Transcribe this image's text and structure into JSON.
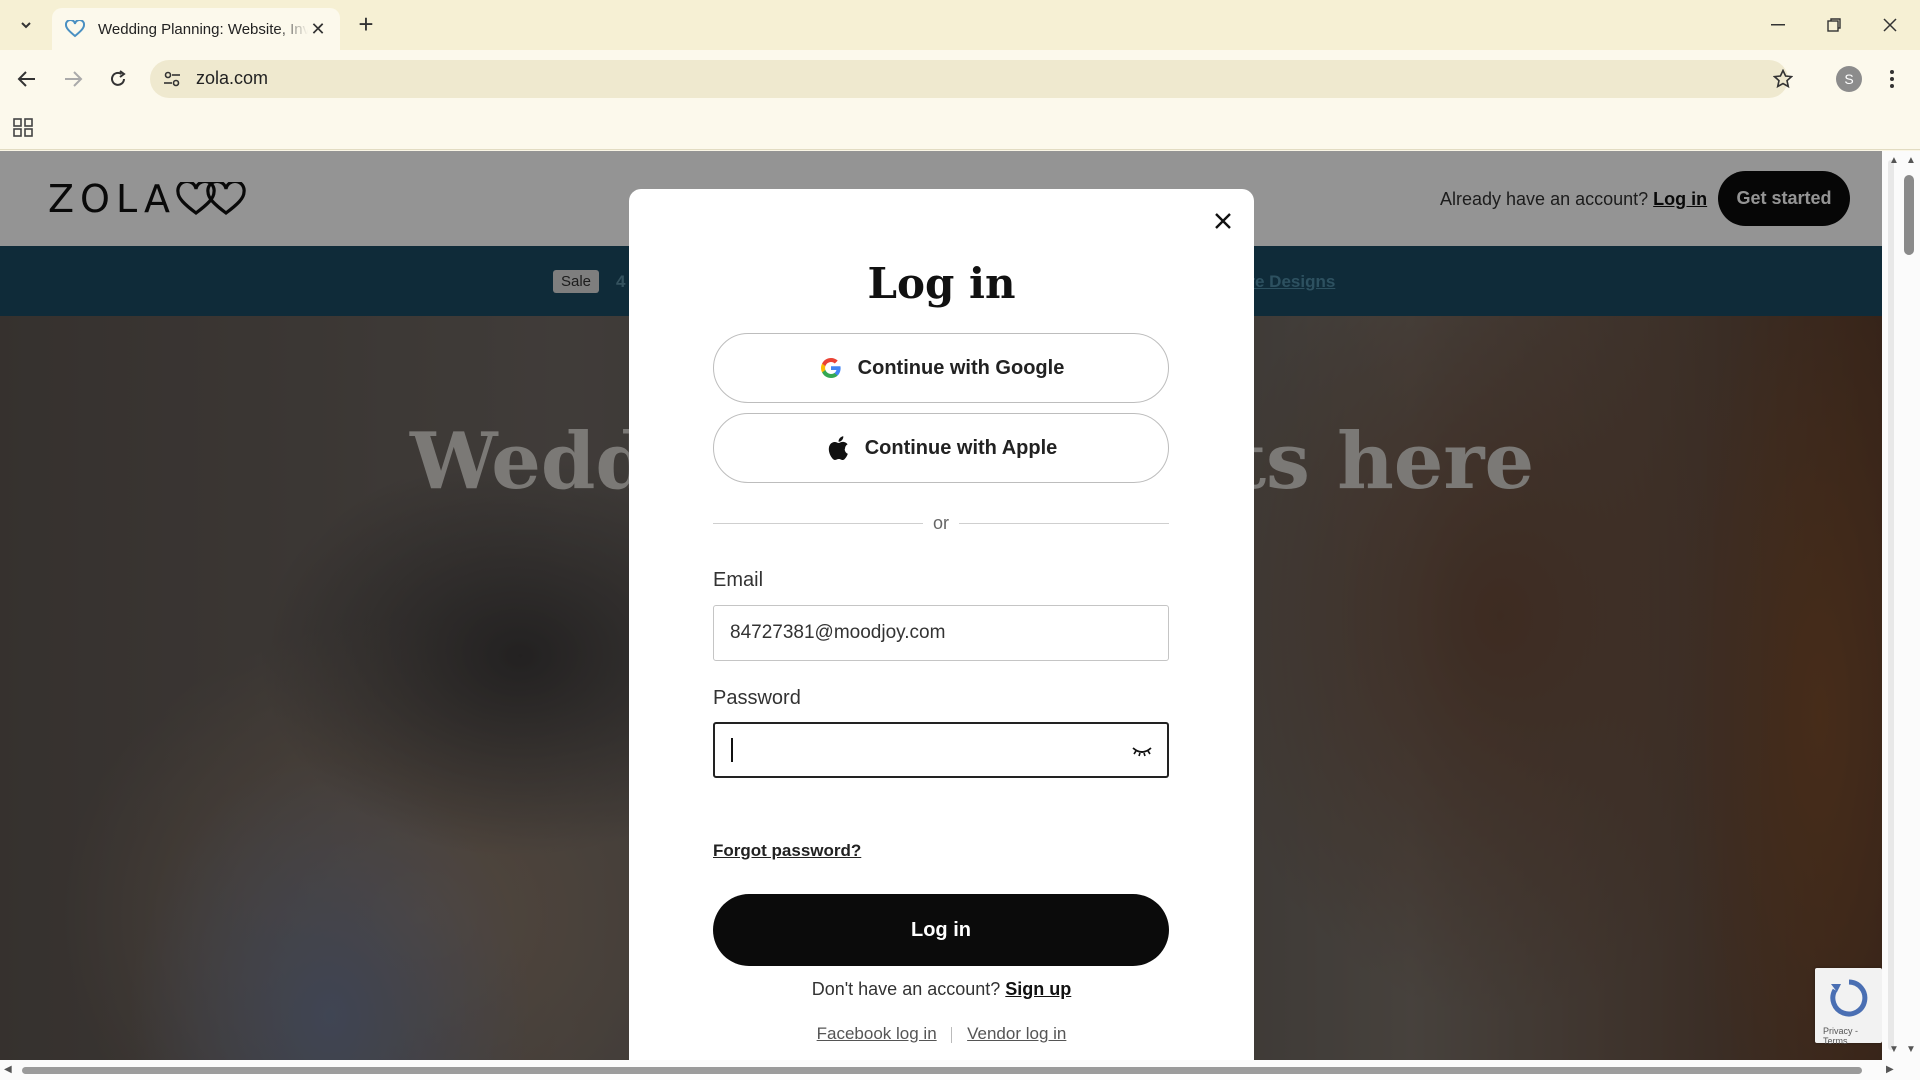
{
  "browser": {
    "tab_title": "Wedding Planning: Website, Invitations",
    "url": "zola.com",
    "profile_initial": "S",
    "accent": "#f6f0d4"
  },
  "header": {
    "logo_text": "ZOLA",
    "already_text": "Already have an account?",
    "login_link": "Log in",
    "get_started": "Get started"
  },
  "promo": {
    "sale_badge": "Sale",
    "left_text": "4",
    "link_text": "ore Designs"
  },
  "hero": {
    "left_fragment": "Wedd",
    "right_fragment": "ts here"
  },
  "modal": {
    "title": "Log in",
    "google_label": "Continue with Google",
    "apple_label": "Continue with Apple",
    "or_text": "or",
    "email_label": "Email",
    "email_value": "84727381@moodjoy.com",
    "password_label": "Password",
    "password_value": "",
    "forgot_label": "Forgot password?",
    "login_button": "Log in",
    "signup_prompt": "Don't have an account?",
    "signup_link": "Sign up",
    "facebook_link": "Facebook log in",
    "vendor_link": "Vendor log in"
  },
  "recaptcha": {
    "text": "Privacy - Terms"
  },
  "icons": {
    "tab_favicon": "heart-icon",
    "site_info": "tune-icon",
    "bookmark": "star-icon",
    "apps": "grid-icon",
    "password_toggle": "eye-closed-icon"
  }
}
